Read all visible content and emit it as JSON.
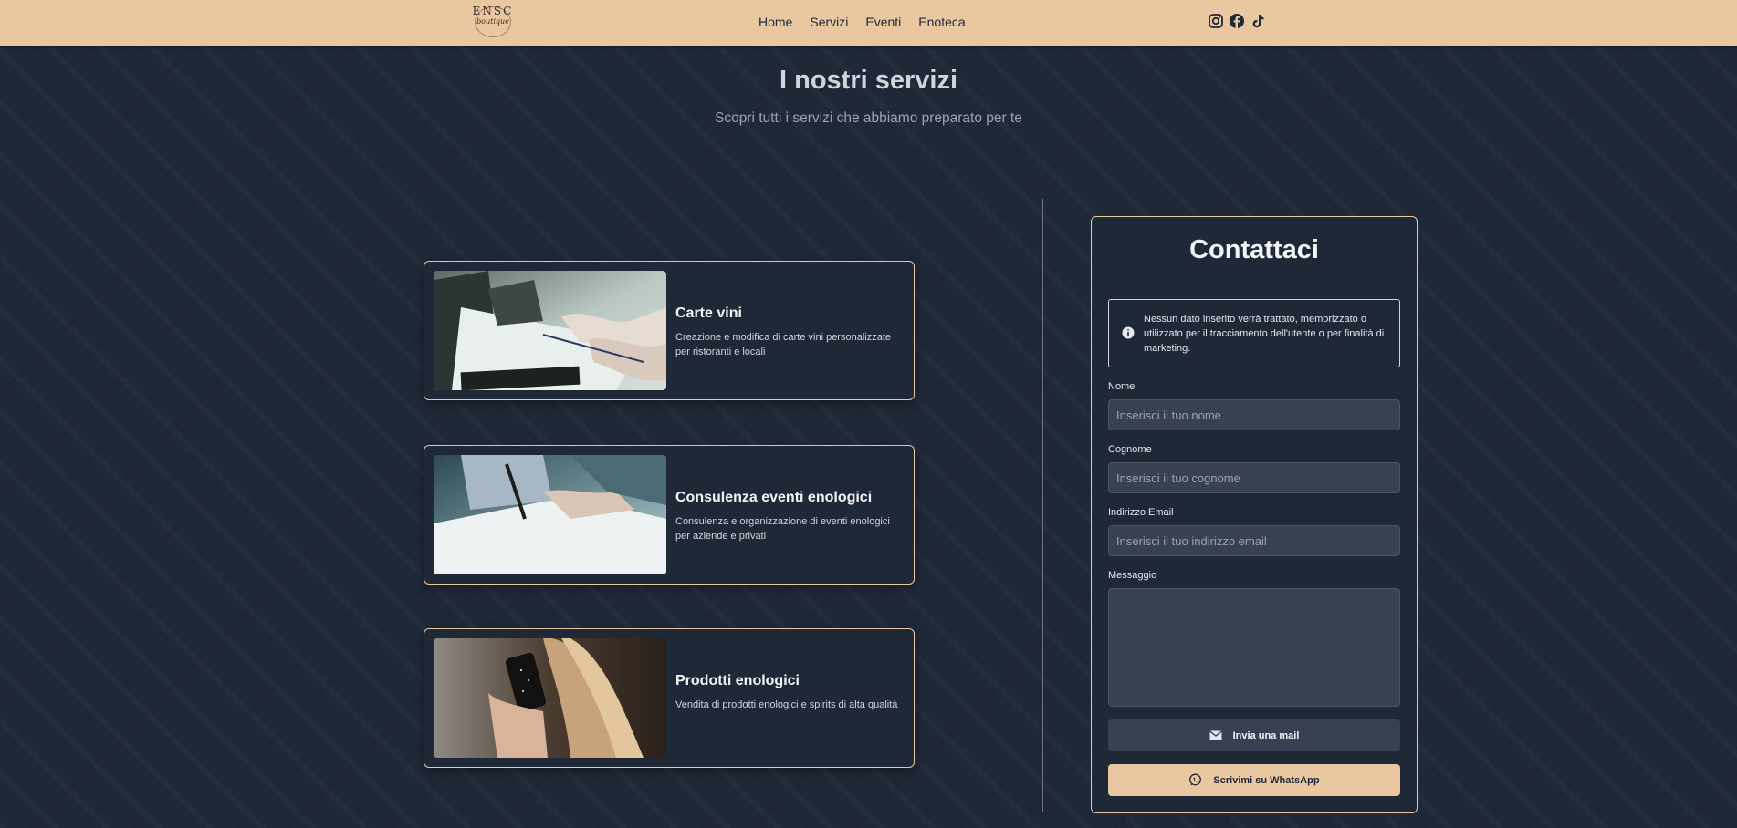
{
  "header": {
    "logo": {
      "line1": "ENSC",
      "line2": "boutique"
    },
    "nav": [
      "Home",
      "Servizi",
      "Eventi",
      "Enoteca"
    ],
    "socials": [
      "instagram-icon",
      "facebook-icon",
      "tiktok-icon"
    ]
  },
  "hero": {
    "title": "I nostri servizi",
    "subtitle": "Scopri tutti i servizi che abbiamo preparato per te"
  },
  "services": [
    {
      "title": "Carte vini",
      "description": "Creazione e modifica di carte vini personalizzate per ristoranti e locali"
    },
    {
      "title": "Consulenza eventi enologici",
      "description": "Consulenza e organizzazione di eventi enologici per aziende e privati"
    },
    {
      "title": "Prodotti enologici",
      "description": "Vendita di prodotti enologici e spirits di alta qualità"
    }
  ],
  "contact": {
    "title": "Contattaci",
    "notice": "Nessun dato inserito verrà trattato, memorizzato o utilizzato per il tracciamento dell'utente o per finalità di marketing.",
    "fields": {
      "nome": {
        "label": "Nome",
        "placeholder": "Inserisci il tuo nome"
      },
      "cognome": {
        "label": "Cognome",
        "placeholder": "Inserisci il tuo cognome"
      },
      "email": {
        "label": "Indirizzo Email",
        "placeholder": "Inserisci il tuo indirizzo email"
      },
      "messaggio": {
        "label": "Messaggio",
        "placeholder": ""
      }
    },
    "mail_button": "Invia una mail",
    "whatsapp_button": "Scrivimi su WhatsApp"
  },
  "colors": {
    "accent": "#e8c7a1",
    "background": "#1f2837",
    "input": "#374151"
  }
}
